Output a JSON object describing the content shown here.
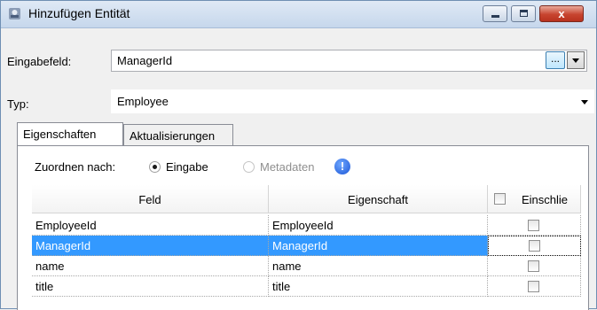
{
  "window": {
    "title": "Hinzufügen Entität",
    "close_glyph": "x"
  },
  "form": {
    "input_field_label": "Eingabefeld:",
    "input_field_value": "ManagerId",
    "browse_button_label": "...",
    "type_label": "Typ:",
    "type_value": "Employee"
  },
  "tabs": [
    {
      "label": "Eigenschaften",
      "active": true
    },
    {
      "label": "Aktualisierungen",
      "active": false
    }
  ],
  "mapping": {
    "label": "Zuordnen nach:",
    "option_input": "Eingabe",
    "option_metadata": "Metadaten",
    "info_glyph": "!"
  },
  "grid": {
    "columns": [
      "Feld",
      "Eigenschaft",
      "Einschlie"
    ],
    "rows": [
      {
        "field": "EmployeeId",
        "property": "EmployeeId",
        "selected": false
      },
      {
        "field": "ManagerId",
        "property": "ManagerId",
        "selected": true
      },
      {
        "field": "name",
        "property": "name",
        "selected": false
      },
      {
        "field": "title",
        "property": "title",
        "selected": false
      }
    ]
  },
  "colors": {
    "selection": "#3399ff",
    "close_button": "#c7442f"
  }
}
